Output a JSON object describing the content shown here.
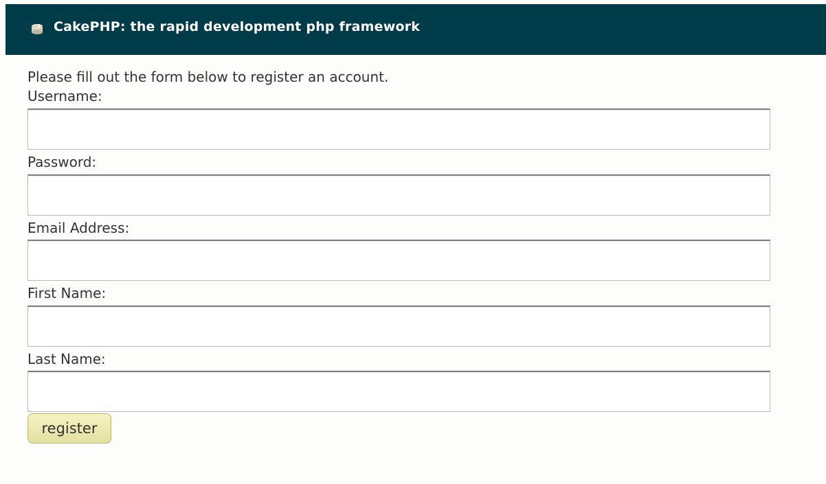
{
  "header": {
    "title": "CakePHP: the rapid development php framework",
    "logo_icon": "cake-icon",
    "background_color": "#003b4a"
  },
  "form": {
    "intro": "Please fill out the form below to register an account.",
    "fields": [
      {
        "label": "Username:",
        "value": ""
      },
      {
        "label": "Password:",
        "value": ""
      },
      {
        "label": "Email Address:",
        "value": ""
      },
      {
        "label": "First Name:",
        "value": ""
      },
      {
        "label": "Last Name:",
        "value": ""
      }
    ],
    "submit_label": "register"
  }
}
